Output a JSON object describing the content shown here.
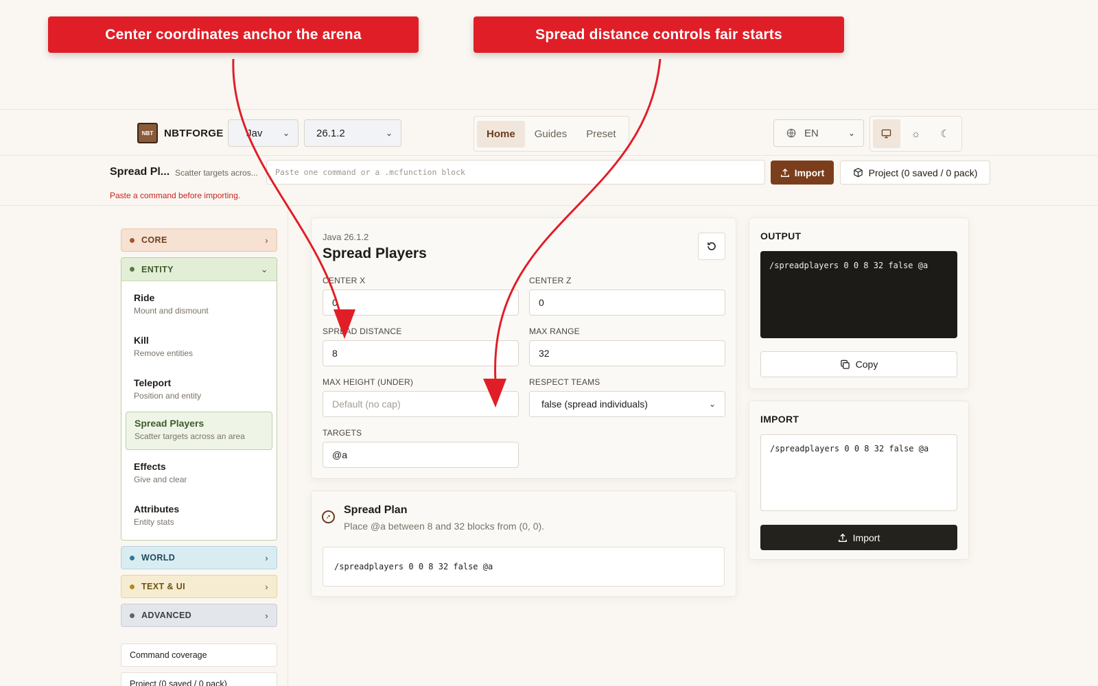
{
  "callouts": [
    "Center coordinates anchor the arena",
    "Spread distance controls fair starts"
  ],
  "nav": {
    "brand": "NBTFORGE",
    "brand_logo_text": "NBT",
    "edition": "Jav",
    "version": "26.1.2",
    "tabs": [
      "Home",
      "Guides",
      "Preset"
    ],
    "active_tab": "Home",
    "language": "EN",
    "theme_icons": [
      "monitor-icon",
      "sun-icon",
      "moon-icon"
    ]
  },
  "command_bar": {
    "title": "Spread Pl...",
    "subtitle": "Scatter targets acros...",
    "input_placeholder": "Paste one command or a .mcfunction block",
    "import_label": "Import",
    "project_label": "Project (0 saved / 0 pack)",
    "error": "Paste a command before importing."
  },
  "sidebar": {
    "categories": {
      "core": "CORE",
      "entity": "ENTITY",
      "world": "WORLD",
      "text_ui": "TEXT & UI",
      "advanced": "ADVANCED"
    },
    "entity_items": [
      {
        "title": "Ride",
        "desc": "Mount and dismount"
      },
      {
        "title": "Kill",
        "desc": "Remove entities"
      },
      {
        "title": "Teleport",
        "desc": "Position and entity"
      },
      {
        "title": "Spread Players",
        "desc": "Scatter targets across an area"
      },
      {
        "title": "Effects",
        "desc": "Give and clear"
      },
      {
        "title": "Attributes",
        "desc": "Entity stats"
      }
    ],
    "active_item": "Spread Players",
    "links": [
      "Command coverage",
      "Project (0 saved / 0 pack)"
    ]
  },
  "editor": {
    "edition_label": "Java 26.1.2",
    "title": "Spread Players",
    "fields": {
      "center_x": {
        "label": "CENTER X",
        "value": "0"
      },
      "center_z": {
        "label": "CENTER Z",
        "value": "0"
      },
      "spread_distance": {
        "label": "SPREAD DISTANCE",
        "value": "8"
      },
      "max_range": {
        "label": "MAX RANGE",
        "value": "32"
      },
      "max_height": {
        "label": "MAX HEIGHT (UNDER)",
        "placeholder": "Default (no cap)"
      },
      "respect_teams": {
        "label": "RESPECT TEAMS",
        "value": "false (spread individuals)"
      },
      "targets": {
        "label": "TARGETS",
        "value": "@a"
      }
    }
  },
  "plan": {
    "title": "Spread Plan",
    "description": "Place @a between 8 and 32 blocks from (0, 0).",
    "command": "/spreadplayers 0 0 8 32 false @a"
  },
  "output": {
    "title": "OUTPUT",
    "command": "/spreadplayers 0 0 8 32 false @a",
    "copy_label": "Copy"
  },
  "import": {
    "title": "IMPORT",
    "text": "/spreadplayers 0 0 8 32 false @a",
    "button_label": "Import"
  },
  "colors": {
    "callout": "#e01e27",
    "accent": "#7b3e1d",
    "entity_green": "#3f5a2c"
  }
}
